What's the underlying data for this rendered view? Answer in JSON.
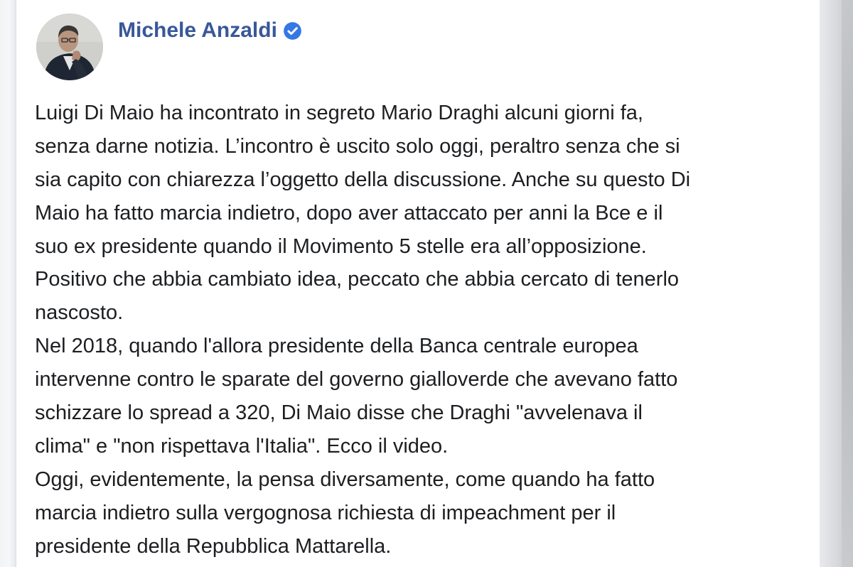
{
  "post": {
    "author": {
      "name": "Michele Anzaldi",
      "verified_icon": "verified-badge-icon",
      "avatar": "profile-photo"
    },
    "lines": [
      "Luigi Di Maio ha incontrato in segreto Mario Draghi alcuni giorni fa,",
      "senza darne notizia. L’incontro è uscito solo oggi, peraltro senza che si",
      "sia capito con chiarezza l’oggetto della discussione. Anche su questo Di",
      "Maio ha fatto marcia indietro, dopo aver attaccato per anni la Bce e il",
      "suo ex presidente quando il Movimento 5 stelle era all’opposizione.",
      "Positivo che abbia cambiato idea, peccato che abbia cercato di tenerlo",
      "nascosto.",
      "Nel 2018, quando l'allora presidente della Banca centrale europea",
      "intervenne contro le sparate del governo gialloverde che avevano fatto",
      "schizzare lo spread a 320, Di Maio disse che Draghi \"avvelenava il",
      "clima\" e \"non rispettava l'Italia\". Ecco il video.",
      "Oggi, evidentemente, la pensa diversamente, come quando ha fatto",
      "marcia indietro sulla vergognosa richiesta di impeachment per il",
      "presidente della Repubblica Mattarella."
    ]
  },
  "colors": {
    "author_name": "#385898",
    "verified_badge": "#3578e5",
    "body_text": "#1c1e21",
    "card_background": "#ffffff",
    "card_border": "#dddfe2"
  }
}
